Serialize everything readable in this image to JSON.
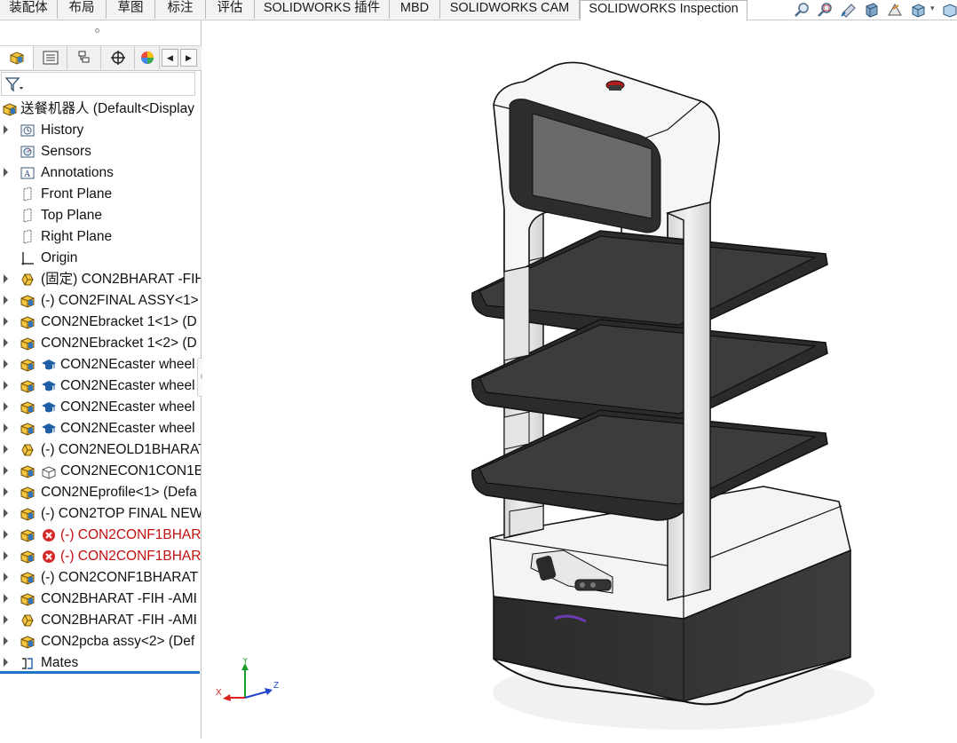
{
  "tabs": [
    {
      "label": "装配体",
      "active": false
    },
    {
      "label": "布局",
      "active": false
    },
    {
      "label": "草图",
      "active": false
    },
    {
      "label": "标注",
      "active": false
    },
    {
      "label": "评估",
      "active": false
    },
    {
      "label": "SOLIDWORKS 插件",
      "active": false
    },
    {
      "label": "MBD",
      "active": false
    },
    {
      "label": "SOLIDWORKS CAM",
      "active": false
    },
    {
      "label": "SOLIDWORKS Inspection",
      "active": true
    }
  ],
  "view_tools": [
    "zoom-to-fit-icon",
    "zoom-to-area-icon",
    "previous-view-icon",
    "section-view-icon",
    "view-orientation-icon",
    "display-style-icon",
    "hide-show-icon"
  ],
  "manager_tabs": [
    "featuremanager-icon",
    "propertymanager-icon",
    "configurationmanager-icon",
    "dimxpert-icon",
    "displaymanager-icon"
  ],
  "tree": {
    "root": "送餐机器人  (Default<Display",
    "items": [
      {
        "label": "History",
        "icon": "history-icon",
        "expander": true,
        "error": false
      },
      {
        "label": "Sensors",
        "icon": "sensors-icon",
        "expander": false,
        "error": false
      },
      {
        "label": "Annotations",
        "icon": "annotations-icon",
        "expander": true,
        "error": false
      },
      {
        "label": "Front Plane",
        "icon": "plane-icon",
        "expander": false,
        "error": false
      },
      {
        "label": "Top Plane",
        "icon": "plane-icon",
        "expander": false,
        "error": false
      },
      {
        "label": "Right Plane",
        "icon": "plane-icon",
        "expander": false,
        "error": false
      },
      {
        "label": "Origin",
        "icon": "origin-icon",
        "expander": false,
        "error": false
      },
      {
        "label": "(固定) CON2BHARAT -FIH",
        "icon": "part-icon",
        "expander": true,
        "error": false
      },
      {
        "label": "(-) CON2FINAL ASSY<1>",
        "icon": "assembly-icon",
        "expander": true,
        "error": false
      },
      {
        "label": "CON2NEbracket 1<1> (D",
        "icon": "assembly-icon",
        "expander": true,
        "error": false
      },
      {
        "label": "CON2NEbracket 1<2> (D",
        "icon": "assembly-icon",
        "expander": true,
        "error": false
      },
      {
        "label": "CON2NEcaster wheel",
        "icon": "assembly-icon",
        "secondary_icon": "toolbox-icon",
        "expander": true,
        "error": false
      },
      {
        "label": "CON2NEcaster wheel",
        "icon": "assembly-icon",
        "secondary_icon": "toolbox-icon",
        "expander": true,
        "error": false
      },
      {
        "label": "CON2NEcaster wheel",
        "icon": "assembly-icon",
        "secondary_icon": "toolbox-icon",
        "expander": true,
        "error": false
      },
      {
        "label": "CON2NEcaster wheel",
        "icon": "assembly-icon",
        "secondary_icon": "toolbox-icon",
        "expander": true,
        "error": false
      },
      {
        "label": "(-) CON2NEOLD1BHARAT",
        "icon": "part-icon",
        "expander": true,
        "error": false
      },
      {
        "label": "CON2NECON1CON1B",
        "icon": "assembly-icon",
        "secondary_icon": "envelope-icon",
        "expander": true,
        "error": false
      },
      {
        "label": "CON2NEprofile<1> (Defa",
        "icon": "assembly-icon",
        "expander": true,
        "error": false
      },
      {
        "label": "(-) CON2TOP FINAL NEW",
        "icon": "assembly-icon",
        "expander": true,
        "error": false
      },
      {
        "label": "(-) CON2CONF1BHAR",
        "icon": "assembly-icon",
        "secondary_icon": "error-icon",
        "expander": true,
        "error": true
      },
      {
        "label": "(-) CON2CONF1BHAR",
        "icon": "assembly-icon",
        "secondary_icon": "error-icon",
        "expander": true,
        "error": true
      },
      {
        "label": "(-) CON2CONF1BHARAT",
        "icon": "assembly-icon",
        "expander": true,
        "error": false
      },
      {
        "label": "CON2BHARAT -FIH -AMI",
        "icon": "assembly-icon",
        "expander": true,
        "error": false
      },
      {
        "label": "CON2BHARAT -FIH -AMI",
        "icon": "part-icon",
        "expander": true,
        "error": false
      },
      {
        "label": "CON2pcba assy<2> (Def",
        "icon": "assembly-icon",
        "expander": true,
        "error": false
      },
      {
        "label": "Mates",
        "icon": "mates-icon",
        "expander": true,
        "error": false
      }
    ]
  },
  "triad": {
    "x": "X",
    "y": "Y",
    "z": "Z"
  },
  "colors": {
    "error_text": "#c40f0f",
    "selection_bar": "#1a75c6",
    "robot_dark": "#2f2f2f",
    "robot_light": "#f4f4f4"
  }
}
